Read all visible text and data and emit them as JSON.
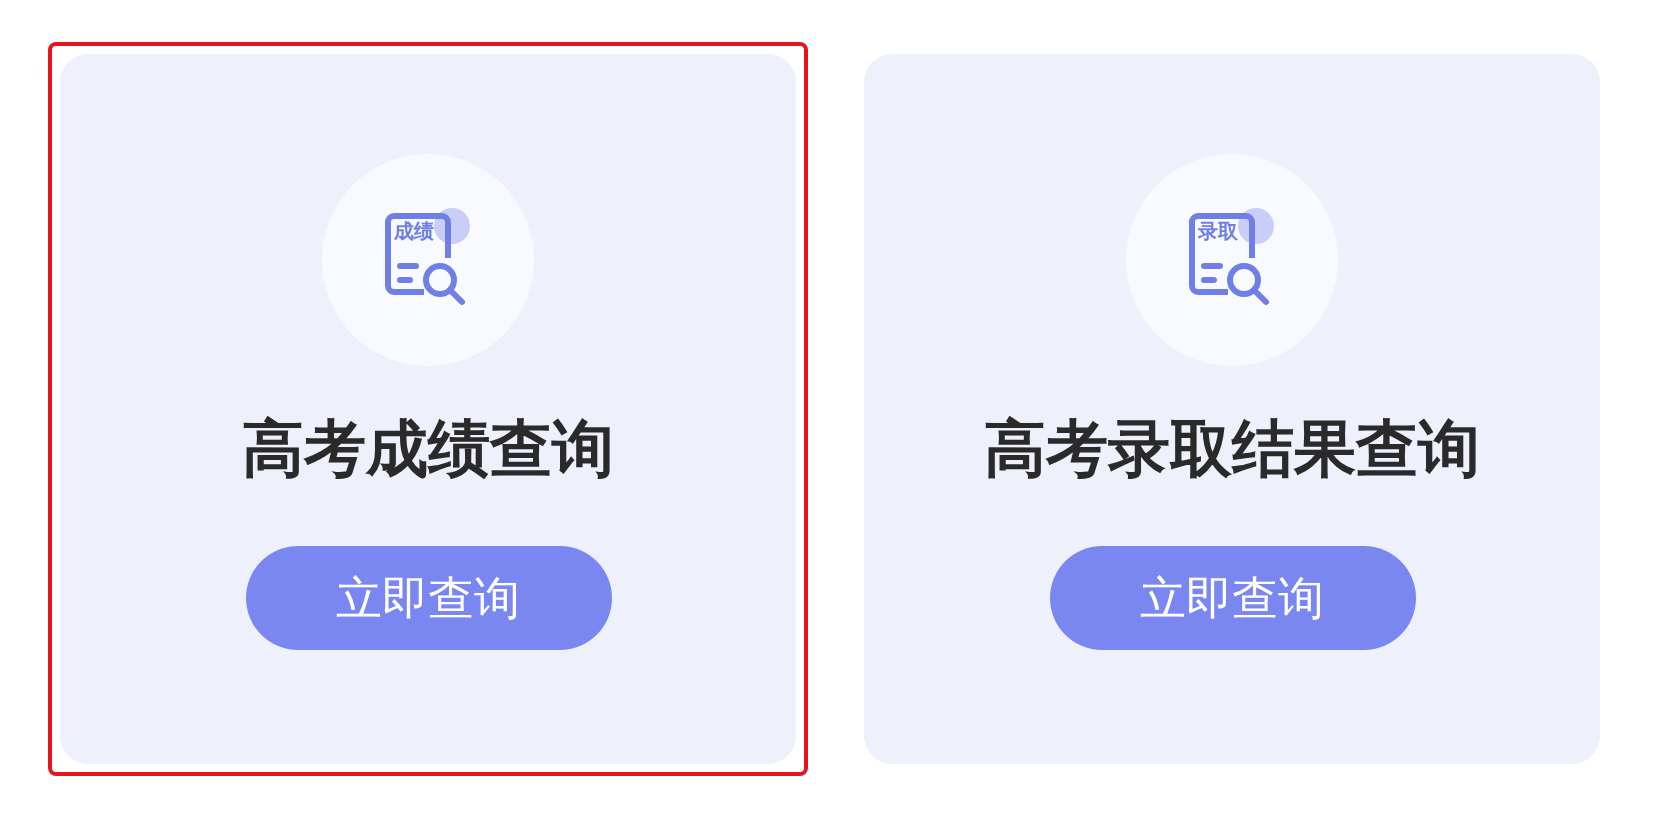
{
  "cards": [
    {
      "icon_label": "成绩",
      "title": "高考成绩查询",
      "button": "立即查询",
      "selected": true
    },
    {
      "icon_label": "录取",
      "title": "高考录取结果查询",
      "button": "立即查询",
      "selected": false
    }
  ]
}
